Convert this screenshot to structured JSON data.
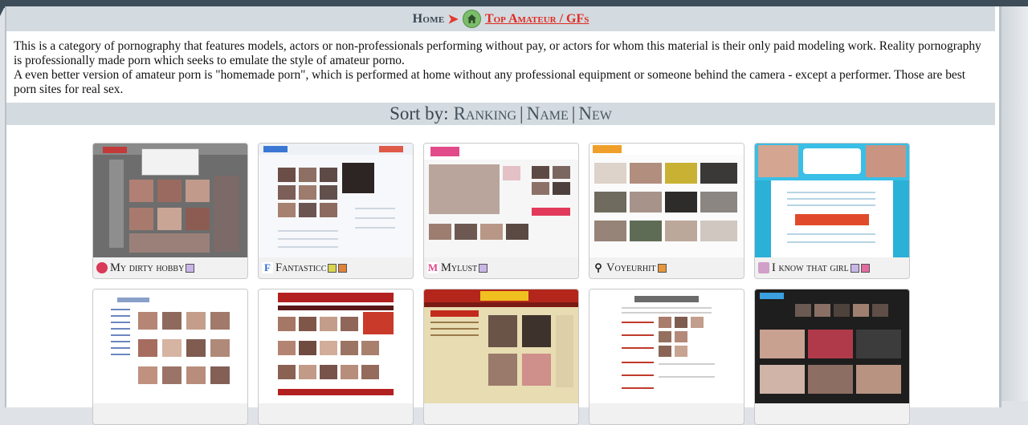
{
  "breadcrumb": {
    "home": "Home",
    "current": "Top Amateur / GFs"
  },
  "intro": {
    "p1": "This is a category of pornography that features models, actors or non-professionals performing without pay, or actors for whom this material is their only paid modeling work. Reality pornography is professionally made porn which seeks to emulate the style of amateur porno.",
    "p2": "A even better version of amateur porn is \"homemade porn\", which is performed at home without any professional equipment or someone behind the camera - except a performer. Those are best porn sites for real sex."
  },
  "sort": {
    "label": "Sort by:",
    "ranking": "Ranking",
    "name": "Name",
    "new": "New",
    "separator": "|"
  },
  "sites": [
    {
      "name": "My dirty hobby",
      "icon": "mdh-logo-icon",
      "icon_color": "#d83a57",
      "flags": [
        "#c8b6e8"
      ],
      "theme": "dark"
    },
    {
      "name": "Fantasticc",
      "icon": "fantasticc-logo-icon",
      "icon_color": "#2f6fd0",
      "flags": [
        "#d9d450",
        "#e0833a"
      ],
      "theme": "light-blue"
    },
    {
      "name": "Mylust",
      "icon": "mylust-logo-icon",
      "icon_color": "#e0478c",
      "flags": [
        "#c8b6e8"
      ],
      "theme": "pink"
    },
    {
      "name": "Voyeurhit",
      "icon": "keyhole-icon",
      "icon_color": "#222222",
      "flags": [
        "#e6963c"
      ],
      "theme": "gallery"
    },
    {
      "name": "I know that girl",
      "icon": "iknowthatgirl-logo-icon",
      "icon_color": "#d1a0c8",
      "flags": [
        "#c8b6e8",
        "#e46aa0"
      ],
      "theme": "cyan"
    },
    {
      "name": "",
      "theme": "white-list"
    },
    {
      "name": "",
      "theme": "red-grid"
    },
    {
      "name": "",
      "theme": "tan"
    },
    {
      "name": "",
      "theme": "white-text"
    },
    {
      "name": "",
      "theme": "black"
    }
  ]
}
